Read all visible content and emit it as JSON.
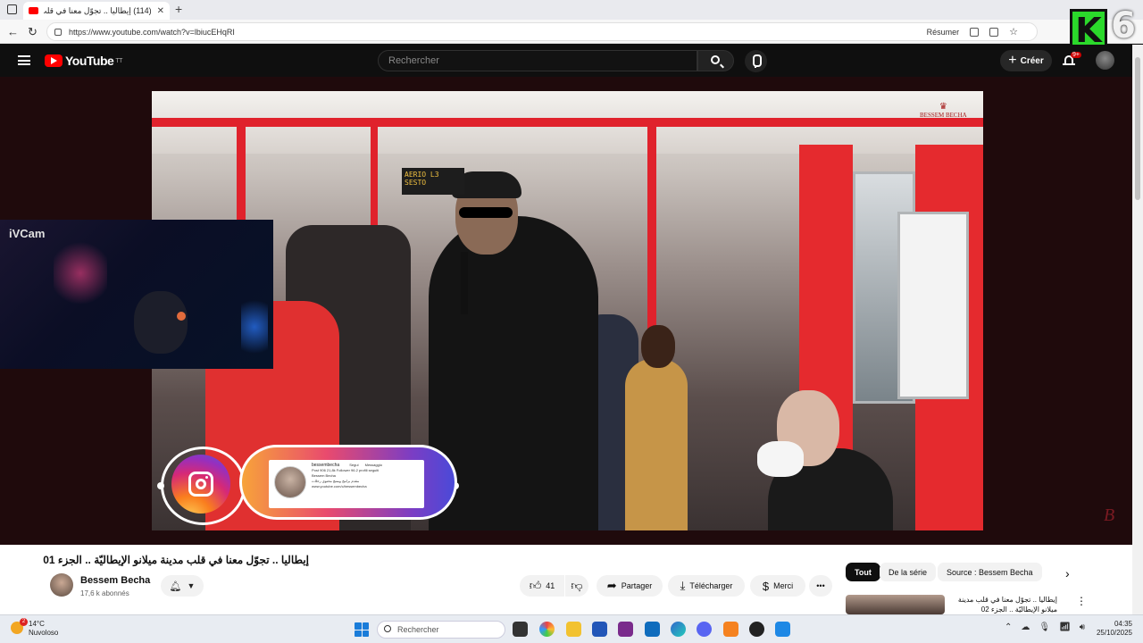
{
  "browser": {
    "tab_title": "(114) إيطاليا .. تجوّل معنا في قلب",
    "tab_close": "✕",
    "new_tab": "+",
    "url": "https://www.youtube.com/watch?v=lbiucEHqRI",
    "reader_label": "Résumer",
    "overlay_k": "K",
    "overlay_number": "6",
    "menu_dots": "⋯"
  },
  "youtube_header": {
    "logo_text": "YouTube",
    "logo_country": "TT",
    "search_placeholder": "Rechercher",
    "create_label": "Créer",
    "notif_badge": "9+"
  },
  "video": {
    "sign_line1": "AERIO L3",
    "sign_line2": "SESTO",
    "watermark": "BESSEM BECHA",
    "corner_mark": "B",
    "ivcam_label": "iVCam",
    "ig_card": {
      "handle": "bessembecha",
      "stats": "Post 906   21,8k Follower   96.2 profili seguiti",
      "name": "Bessem Becha",
      "bio": "مقدم برامج ومنتج محتوى رحلات",
      "link": "www.youtube.com/c/bessembecha",
      "follow": "Segui",
      "message": "Messaggio"
    }
  },
  "below_video": {
    "title": "إيطاليا .. تجوّل معنا في قلب مدينة ميلانو الإيطاليّة .. الجزء 01",
    "channel_name": "Bessem Becha",
    "subscribers": "17,6 k abonnés",
    "like_count": "41",
    "share_label": "Partager",
    "download_label": "Télécharger",
    "thanks_label": "Merci",
    "more": "•••"
  },
  "recommendations": {
    "chips": [
      "Tout",
      "De la série",
      "Source : Bessem Becha"
    ],
    "first_title": "إيطاليا .. تجوّل معنا في قلب مدينة ميلانو الإيطاليّة .. الجزء 02"
  },
  "taskbar": {
    "temperature": "14°C",
    "weather": "Nuvoloso",
    "weather_badge": "2",
    "search_placeholder": "Rechercher",
    "time": "04:35",
    "date": "25/10/2025"
  },
  "colors": {
    "yt_red": "#ff0000",
    "player_bg": "#1f0a0c",
    "k_badge": "#2bd92b"
  }
}
